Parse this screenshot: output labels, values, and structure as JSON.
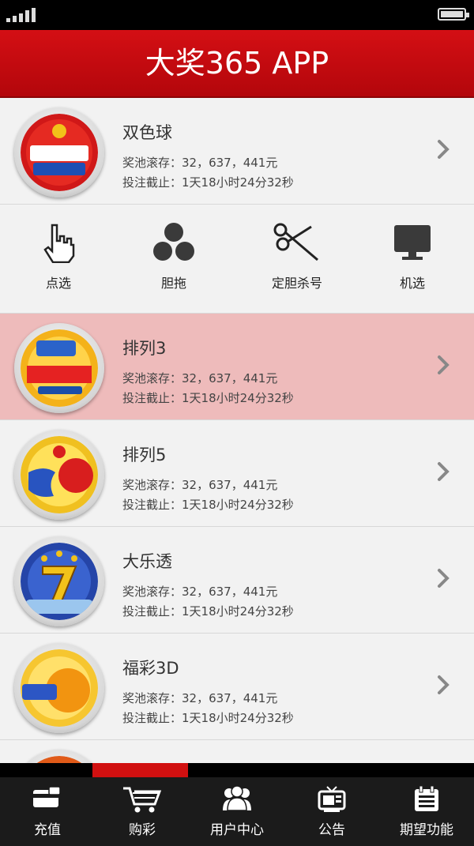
{
  "header": {
    "title": "大奖365 APP"
  },
  "lotteries": [
    {
      "name": "双色球",
      "logo": "union-lotto-logo",
      "pool": "奖池滚存：32，637，441元",
      "deadline": "投注截止：1天18小时24分32秒",
      "highlight": false
    },
    {
      "name": "排列3",
      "logo": "super-lotto-logo",
      "pool": "奖池滚存：32，637，441元",
      "deadline": "投注截止：1天18小时24分32秒",
      "highlight": true
    },
    {
      "name": "排列5",
      "logo": "3d-logo",
      "pool": "奖池滚存：32，637，441元",
      "deadline": "投注截止：1天18小时24分32秒",
      "highlight": false
    },
    {
      "name": "大乐透",
      "logo": "7-star-logo",
      "pool": "奖池滚存：32，637，441元",
      "deadline": "投注截止：1天18小时24分32秒",
      "highlight": false
    },
    {
      "name": "福彩3D",
      "logo": "pailie-3-logo",
      "pool": "奖池滚存：32，637，441元",
      "deadline": "投注截止：1天18小时24分32秒",
      "highlight": false
    }
  ],
  "actions": [
    {
      "label": "点选",
      "icon": "pointer-hand-icon"
    },
    {
      "label": "胆拖",
      "icon": "three-balls-icon"
    },
    {
      "label": "定胆杀号",
      "icon": "scissors-icon"
    },
    {
      "label": "机选",
      "icon": "monitor-icon"
    }
  ],
  "tabs": [
    {
      "label": "充值",
      "icon": "card-icon"
    },
    {
      "label": "购彩",
      "icon": "cart-icon"
    },
    {
      "label": "用户中心",
      "icon": "users-icon"
    },
    {
      "label": "公告",
      "icon": "news-tv-icon"
    },
    {
      "label": "期望功能",
      "icon": "calendar-list-icon"
    }
  ],
  "colors": {
    "brand_red": "#c80a10",
    "highlight_row": "#eebbbb",
    "tabbar": "#1b1b1b"
  }
}
